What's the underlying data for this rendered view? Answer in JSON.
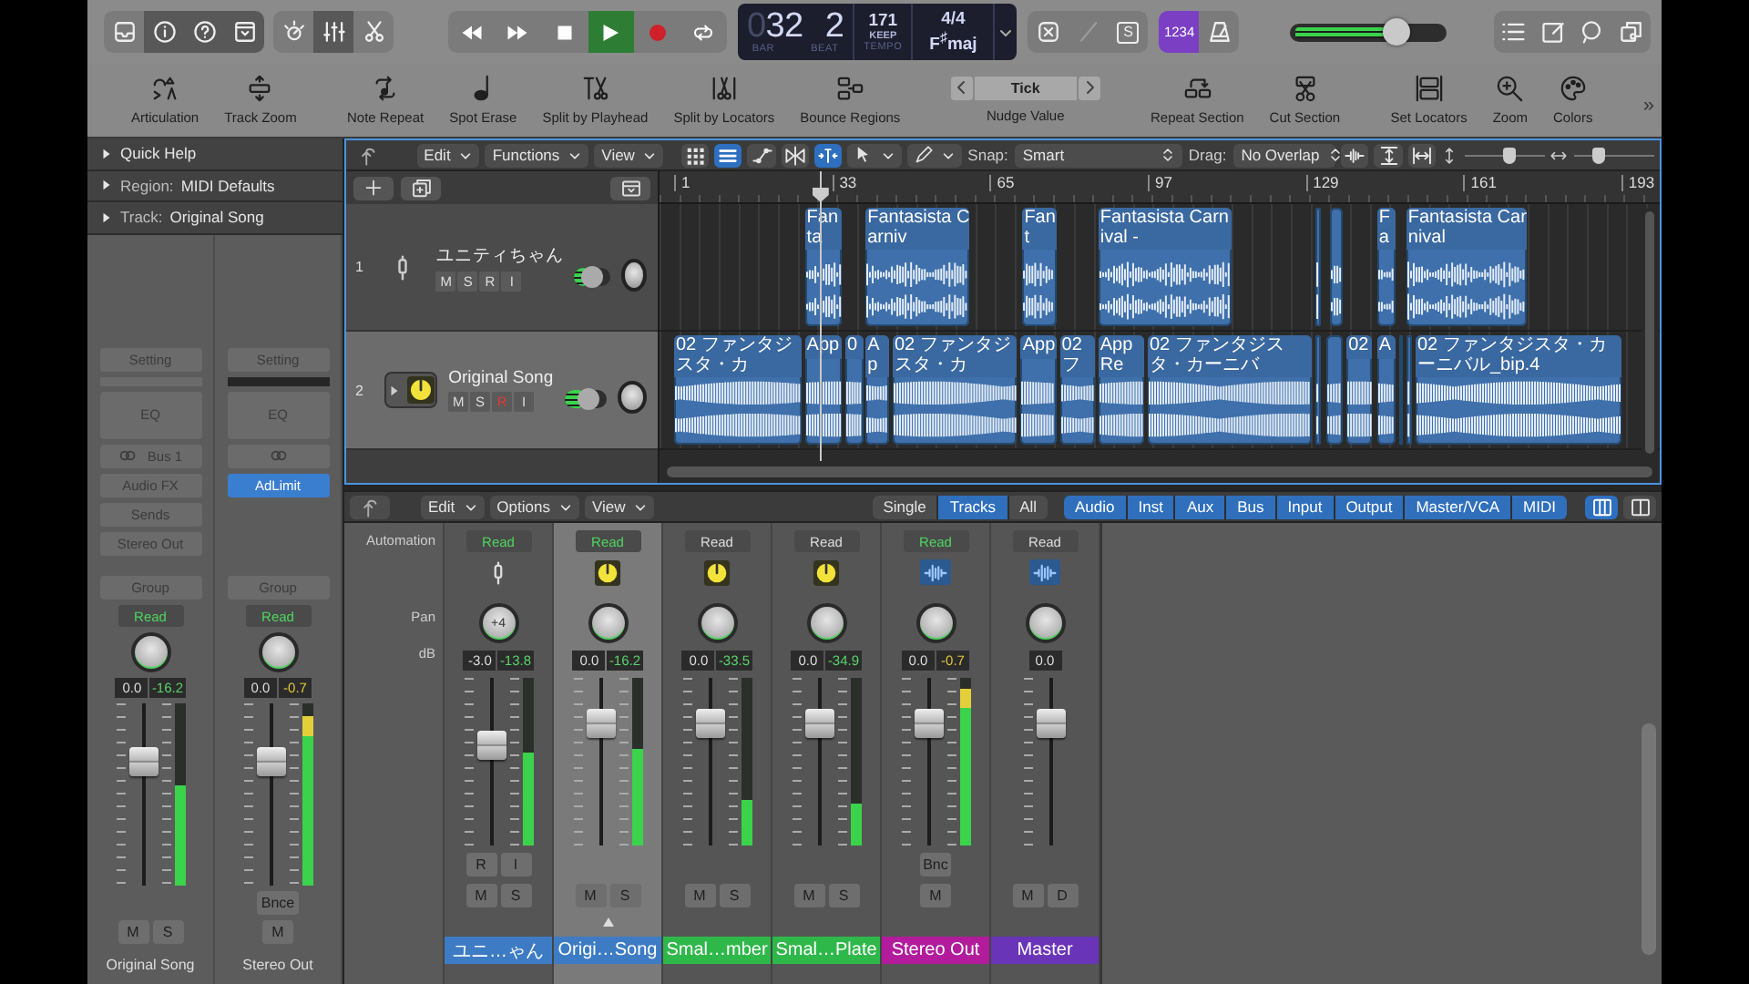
{
  "control_bar": {
    "view_buttons": [
      {
        "kind": "library",
        "selected": false
      },
      {
        "kind": "inspector",
        "selected": true
      },
      {
        "kind": "quick_help",
        "selected": true
      },
      {
        "kind": "toolbar",
        "selected": true
      }
    ],
    "mode_buttons": [
      {
        "kind": "smart_controls",
        "selected": false
      },
      {
        "kind": "mixer",
        "selected": true
      },
      {
        "kind": "editors",
        "selected": false
      }
    ],
    "transport": [
      {
        "kind": "rewind",
        "on": false
      },
      {
        "kind": "forward",
        "on": false
      },
      {
        "kind": "stop",
        "on": false
      },
      {
        "kind": "play",
        "on": true
      },
      {
        "kind": "record",
        "on": false
      },
      {
        "kind": "cycle",
        "on": false
      }
    ],
    "lcd": {
      "bar_pad": "0",
      "bar": "32",
      "beat": "2",
      "bar_label": "BAR",
      "beat_label": "BEAT",
      "tempo": "171",
      "tempo_mode": "KEEP",
      "tempo_label": "TEMPO",
      "signature": "4/4",
      "key": "F$^{♯}$maj"
    },
    "edit_modes": [
      {
        "kind": "replace",
        "disabled": false
      },
      {
        "kind": "autopunch",
        "disabled": true
      },
      {
        "kind": "solo",
        "label": "S",
        "disabled": false
      }
    ],
    "count_in": {
      "label": "1234",
      "on": true
    },
    "metronome": {
      "on": false
    },
    "master_volume": {
      "level": 0.68
    },
    "window_buttons": [
      {
        "kind": "list_editors"
      },
      {
        "kind": "note_pad"
      },
      {
        "kind": "loop_browser"
      },
      {
        "kind": "browsers"
      }
    ]
  },
  "toolbar": {
    "groups": [
      [
        {
          "kind": "articulation",
          "label": "Articulation"
        },
        {
          "kind": "track_zoom",
          "label": "Track Zoom"
        }
      ],
      [
        {
          "kind": "note_repeat",
          "label": "Note Repeat"
        },
        {
          "kind": "spot_erase",
          "label": "Spot Erase"
        },
        {
          "kind": "split_playhead",
          "label": "Split by Playhead"
        },
        {
          "kind": "split_locators",
          "label": "Split by Locators"
        },
        {
          "kind": "bounce",
          "label": "Bounce Regions"
        }
      ],
      [
        {
          "kind": "nudge",
          "label": "Nudge Value",
          "value": "Tick"
        }
      ],
      [
        {
          "kind": "repeat_section",
          "label": "Repeat Section"
        },
        {
          "kind": "cut_section",
          "label": "Cut Section"
        }
      ],
      [
        {
          "kind": "set_locators",
          "label": "Set Locators"
        },
        {
          "kind": "zoom",
          "label": "Zoom"
        },
        {
          "kind": "colors",
          "label": "Colors"
        }
      ]
    ],
    "more": "»"
  },
  "inspector": {
    "sections": [
      {
        "title": "Quick Help"
      },
      {
        "prefix": "Region:",
        "title": "MIDI Defaults"
      },
      {
        "prefix": "Track:",
        "title": "Original Song"
      }
    ],
    "strips": [
      {
        "setting": "Setting",
        "eq": "EQ",
        "slots": [
          {
            "kind": "io",
            "label": "Bus 1"
          },
          {
            "kind": "slot",
            "label": "Audio FX"
          },
          {
            "kind": "slot",
            "label": "Sends"
          },
          {
            "kind": "slot",
            "label": "Stereo Out"
          }
        ],
        "group": "Group",
        "automation": "Read",
        "automation_on": true,
        "volume": "0.0",
        "peak": "-16.2",
        "hot": false,
        "fader": {
          "level": 0.72
        },
        "meter": {
          "level": 0.55
        },
        "buttons": [
          "M",
          "S"
        ],
        "name": "Original Song"
      },
      {
        "setting": "Setting",
        "eq": "EQ",
        "slots": [
          {
            "kind": "io"
          },
          {
            "kind": "plugin",
            "label": "AdLimit"
          }
        ],
        "group": "Group",
        "automation": "Read",
        "automation_on": true,
        "volume": "0.0",
        "peak": "-0.7",
        "hot": true,
        "fader": {
          "level": 0.72
        },
        "meter": {
          "level": 0.93
        },
        "extras": [
          "Bnce"
        ],
        "buttons": [
          "M"
        ],
        "name": "Stereo Out"
      }
    ]
  },
  "tracks_area": {
    "menus": [
      "Edit",
      "Functions",
      "View"
    ],
    "tools": [
      {
        "kind": "grid",
        "selected": false
      },
      {
        "kind": "list",
        "selected": true
      },
      {
        "kind": "automation",
        "selected": false
      },
      {
        "kind": "flex",
        "selected": false
      },
      {
        "kind": "catch",
        "selected": true
      }
    ],
    "pointer_tools": [
      {
        "kind": "pointer"
      },
      {
        "kind": "pencil"
      }
    ],
    "snap": {
      "label": "Snap:",
      "value": "Smart"
    },
    "drag": {
      "label": "Drag:",
      "value": "No Overlap"
    },
    "view_tools": [
      {
        "kind": "wave_zoom"
      },
      {
        "kind": "fit_v"
      },
      {
        "kind": "fit_h"
      }
    ],
    "zoom_sliders": [
      {
        "kind": "vertical",
        "level": 0.55
      },
      {
        "kind": "horizontal",
        "level": 0.3
      }
    ],
    "ruler": [
      "1",
      "33",
      "65",
      "97",
      "129",
      "161",
      "193"
    ],
    "tracks": [
      {
        "number": "1",
        "name": "ユニティちゃん",
        "kind": "microphone",
        "selected": false,
        "disclosure": false,
        "buttons": [
          {
            "kind": "mute",
            "label": "M",
            "on": false
          },
          {
            "kind": "solo",
            "label": "S",
            "on": false
          },
          {
            "kind": "record",
            "label": "R",
            "on": false
          },
          {
            "kind": "input",
            "label": "I",
            "on": false
          }
        ],
        "volume": {
          "level": 0.5
        },
        "region_names": [
          "Fanta",
          "Fantasista Carniv",
          "Fant",
          "Fantasista Carnival -",
          "Fa",
          "Fantasista Carnival"
        ]
      },
      {
        "number": "2",
        "name": "Original Song",
        "kind": "plugin",
        "selected": true,
        "disclosure": true,
        "buttons": [
          {
            "kind": "mute",
            "label": "M",
            "on": false
          },
          {
            "kind": "solo",
            "label": "S",
            "on": false
          },
          {
            "kind": "record",
            "label": "R",
            "on": true
          },
          {
            "kind": "input",
            "label": "I",
            "on": false
          }
        ],
        "volume": {
          "level": 0.55
        },
        "region_names": [
          "02 ファンタジスタ・カ",
          "App",
          "0",
          "Ap",
          "02 ファンタジスタ・カ",
          "App",
          "02 フ",
          "App Re",
          "02 ファンタジスタ・カーニバ",
          "02",
          "A",
          "02 ファンタジスタ・カーニバル_bip.4"
        ]
      }
    ]
  },
  "mixer": {
    "menus": [
      "Edit",
      "Options",
      "View"
    ],
    "view_modes": [
      {
        "label": "Single",
        "selected": false
      },
      {
        "label": "Tracks",
        "selected": true
      },
      {
        "label": "All",
        "selected": false
      }
    ],
    "filters": [
      {
        "label": "Audio",
        "on": true
      },
      {
        "label": "Inst",
        "on": true
      },
      {
        "label": "Aux",
        "on": true
      },
      {
        "label": "Bus",
        "on": true
      },
      {
        "label": "Input",
        "on": true
      },
      {
        "label": "Output",
        "on": true
      },
      {
        "label": "Master/VCA",
        "on": true
      },
      {
        "label": "MIDI",
        "on": true
      }
    ],
    "layouts": [
      {
        "kind": "wide",
        "selected": true
      },
      {
        "kind": "narrow",
        "selected": false
      }
    ],
    "row_labels": {
      "automation": "Automation",
      "pan": "Pan",
      "db": "dB"
    },
    "channels": [
      {
        "name": "ユニ…ゃん",
        "color": "#3d7cc4",
        "selected": false,
        "kind": "microphone",
        "automation": "Read",
        "automation_on": true,
        "pan": "+4",
        "volume": "-3.0",
        "peak": "-13.8",
        "hot": false,
        "fader": {
          "level": 0.62
        },
        "meter": {
          "level": 0.55
        },
        "extras": [
          "R",
          "I"
        ],
        "buttons": [
          "M",
          "S"
        ]
      },
      {
        "name": "Origi…Song",
        "color": "#3d7cc4",
        "selected": true,
        "kind": "plugin",
        "automation": "Read",
        "automation_on": true,
        "volume": "0.0",
        "peak": "-16.2",
        "hot": false,
        "fader": {
          "level": 0.78
        },
        "meter": {
          "level": 0.58
        },
        "buttons": [
          "M",
          "S"
        ]
      },
      {
        "name": "Smal…mber",
        "color": "#2fb84a",
        "selected": false,
        "kind": "plugin",
        "automation": "Read",
        "automation_on": false,
        "volume": "0.0",
        "peak": "-33.5",
        "hot": false,
        "fader": {
          "level": 0.78
        },
        "meter": {
          "level": 0.27
        },
        "buttons": [
          "M",
          "S"
        ]
      },
      {
        "name": "Smal…Plate",
        "color": "#2fb84a",
        "selected": false,
        "kind": "plugin",
        "automation": "Read",
        "automation_on": false,
        "volume": "0.0",
        "peak": "-34.9",
        "hot": false,
        "fader": {
          "level": 0.78
        },
        "meter": {
          "level": 0.25
        },
        "buttons": [
          "M",
          "S"
        ]
      },
      {
        "name": "Stereo Out",
        "color": "#b21c9c",
        "selected": false,
        "kind": "audio",
        "automation": "Read",
        "automation_on": true,
        "volume": "0.0",
        "peak": "-0.7",
        "hot": true,
        "fader": {
          "level": 0.78
        },
        "meter": {
          "level": 0.93
        },
        "extras": [
          "Bnc"
        ],
        "buttons": [
          "M"
        ]
      },
      {
        "name": "Master",
        "color": "#6a34b8",
        "selected": false,
        "kind": "audio",
        "automation": "Read",
        "automation_on": false,
        "volume": "0.0",
        "fader": {
          "level": 0.78
        },
        "buttons": [
          "M",
          "D"
        ]
      }
    ]
  }
}
